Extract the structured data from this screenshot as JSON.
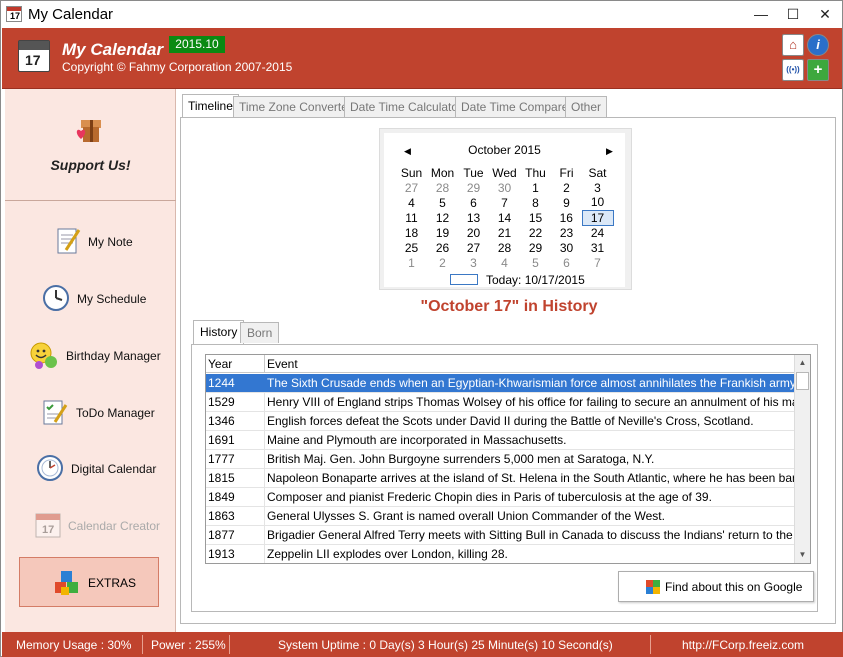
{
  "window": {
    "title": "My Calendar",
    "icon_text": "17",
    "controls": {
      "minimize": "—",
      "maximize": "☐",
      "close": "✕"
    }
  },
  "header": {
    "logo_text": "17",
    "app_title": "My Calendar",
    "version": "2015.10",
    "copyright": "Copyright © Fahmy Corporation 2007-2015",
    "buttons": {
      "home": "⌂",
      "info": "i",
      "broadcast": "((•))",
      "add": "+"
    }
  },
  "sidebar": {
    "support_label": "Support Us!",
    "items": [
      {
        "label": "My Note",
        "icon": "notepad-icon",
        "enabled": true
      },
      {
        "label": "My Schedule",
        "icon": "clock-icon",
        "enabled": true
      },
      {
        "label": "Birthday Manager",
        "icon": "smiley-icon",
        "enabled": true
      },
      {
        "label": "ToDo Manager",
        "icon": "todo-list-icon",
        "enabled": true
      },
      {
        "label": "Digital Calendar",
        "icon": "digital-clock-icon",
        "enabled": true
      },
      {
        "label": "Calendar Creator",
        "icon": "calendar-icon",
        "enabled": false
      }
    ],
    "extras_label": "EXTRAS"
  },
  "tabs": [
    {
      "label": "Timeline",
      "active": true
    },
    {
      "label": "Time Zone Converter",
      "active": false
    },
    {
      "label": "Date Time Calculator",
      "active": false
    },
    {
      "label": "Date Time Comparer",
      "active": false
    },
    {
      "label": "Other",
      "active": false
    }
  ],
  "calendar": {
    "prev": "◀",
    "next": "▶",
    "month_label": "October 2015",
    "weekdays": [
      "Sun",
      "Mon",
      "Tue",
      "Wed",
      "Thu",
      "Fri",
      "Sat"
    ],
    "weeks": [
      [
        "27",
        "28",
        "29",
        "30",
        "1",
        "2",
        "3"
      ],
      [
        "4",
        "5",
        "6",
        "7",
        "8",
        "9",
        "10"
      ],
      [
        "11",
        "12",
        "13",
        "14",
        "15",
        "16",
        "17"
      ],
      [
        "18",
        "19",
        "20",
        "21",
        "22",
        "23",
        "24"
      ],
      [
        "25",
        "26",
        "27",
        "28",
        "29",
        "30",
        "31"
      ],
      [
        "1",
        "2",
        "3",
        "4",
        "5",
        "6",
        "7"
      ]
    ],
    "selected_day": "17",
    "today_label": "Today: 10/17/2015"
  },
  "history": {
    "title": "\"October 17\" in History",
    "subtabs": [
      {
        "label": "History",
        "active": true
      },
      {
        "label": "Born",
        "active": false
      }
    ],
    "columns": {
      "year": "Year",
      "event": "Event"
    },
    "rows": [
      {
        "year": "1244",
        "event": "The Sixth Crusade ends when an Egyptian-Khwarismian force almost annihilates the Frankish army at Gaza."
      },
      {
        "year": "1529",
        "event": "Henry VIII of England strips Thomas Wolsey of his office for failing to secure an annulment of his marriage."
      },
      {
        "year": "1346",
        "event": "English forces defeat the Scots under David II during the Battle of Neville's Cross, Scotland."
      },
      {
        "year": "1691",
        "event": "Maine and Plymouth are incorporated in Massachusetts."
      },
      {
        "year": "1777",
        "event": "British Maj. Gen. John Burgoyne surrenders 5,000 men at Saratoga, N.Y."
      },
      {
        "year": "1815",
        "event": "Napoleon Bonaparte arrives at the island of St. Helena in the South Atlantic, where he has been banished by the"
      },
      {
        "year": "1849",
        "event": "Composer and pianist Frederic Chopin dies in Paris of tuberculosis at the age of 39."
      },
      {
        "year": "1863",
        "event": "General Ulysses S. Grant is named overall Union Commander of the West."
      },
      {
        "year": "1877",
        "event": "Brigadier General Alfred Terry meets with Sitting Bull in Canada to discuss the Indians' return to the United States"
      },
      {
        "year": "1913",
        "event": "Zeppelin LII explodes over London, killing 28."
      }
    ],
    "selected_index": 0,
    "google_button": "Find about this on Google"
  },
  "status": {
    "memory": "Memory Usage : 30%",
    "power": "Power : 255%",
    "uptime": "System Uptime : 0 Day(s) 3 Hour(s) 25 Minute(s) 10 Second(s)",
    "url": "http://FCorp.freeiz.com"
  },
  "colors": {
    "brand": "#c0432e",
    "sidebar": "#fbe7e1",
    "version_badge": "#0a8a12",
    "selection": "#3377d1"
  }
}
